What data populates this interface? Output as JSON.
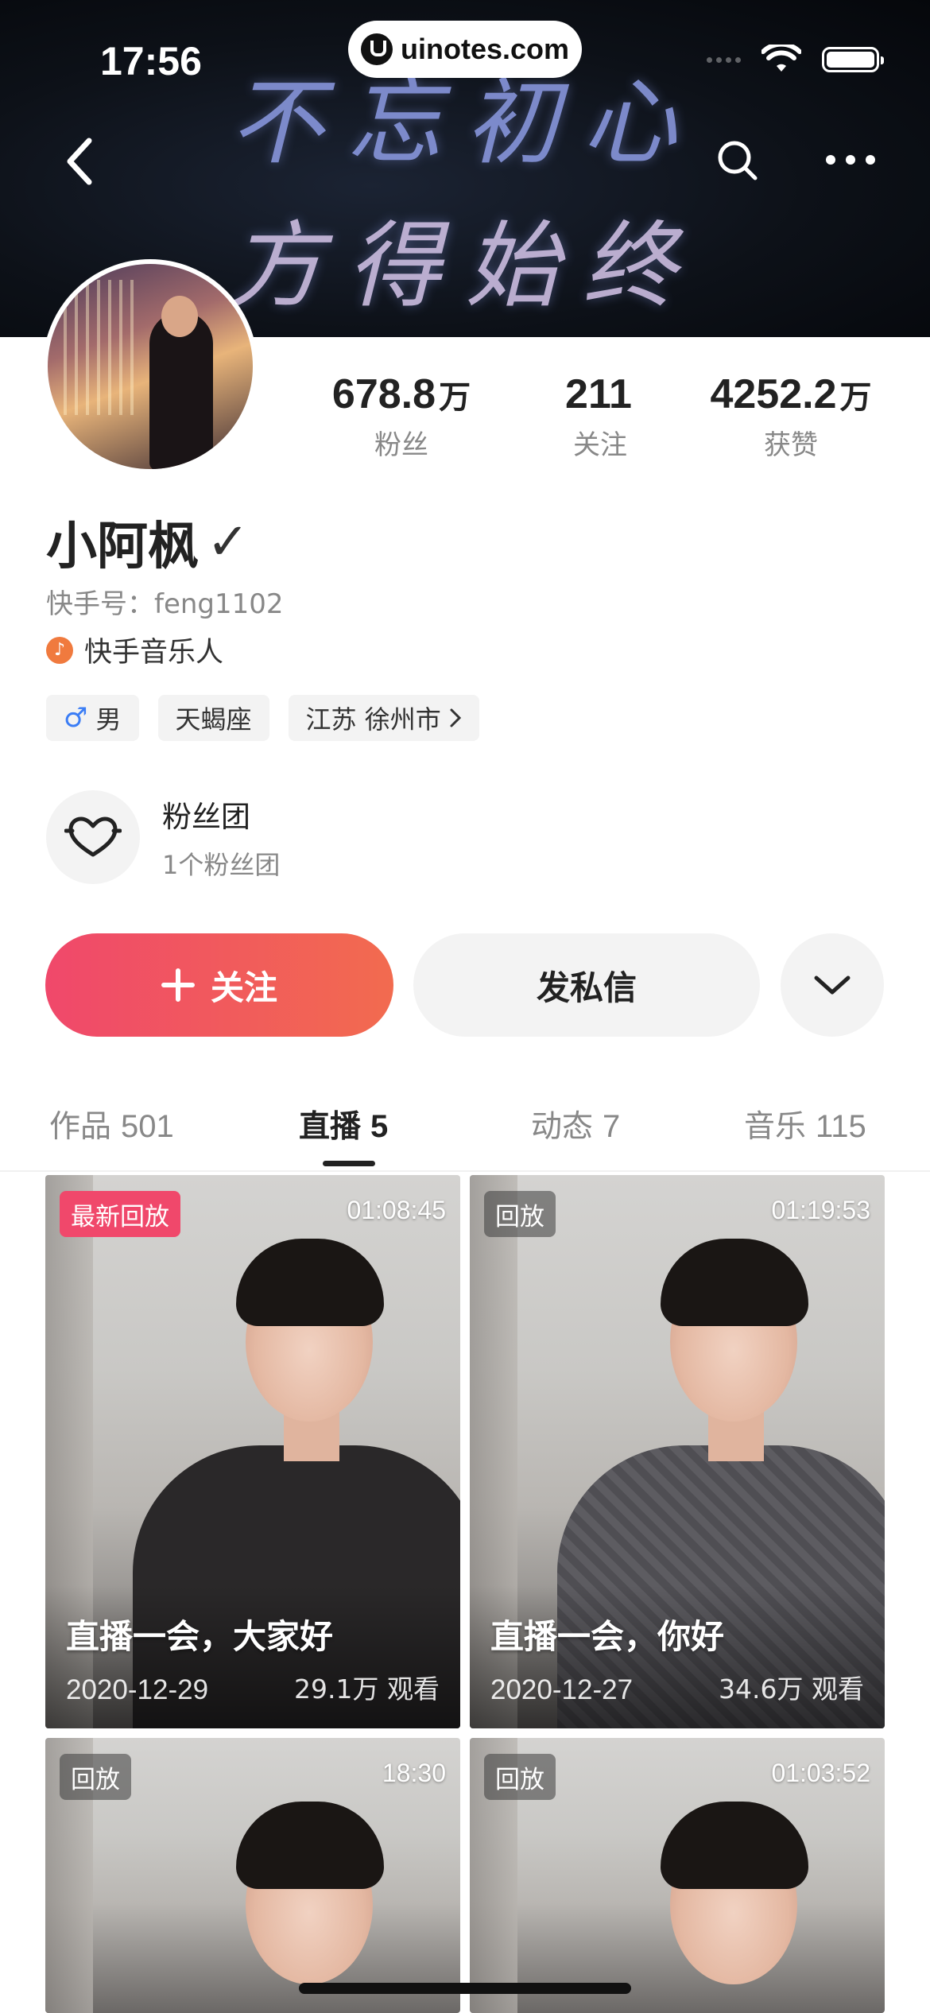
{
  "status_bar": {
    "time": "17:56",
    "url": "uinotes.com"
  },
  "banner": {
    "line1": "不忘初心",
    "line2": "方得始终"
  },
  "nav": {
    "back_icon": "chevron-left-icon",
    "search_icon": "search-icon",
    "more_icon": "more-horizontal-icon"
  },
  "stats": [
    {
      "value": "678.8",
      "unit": "万",
      "label": "粉丝"
    },
    {
      "value": "211",
      "unit": "",
      "label": "关注"
    },
    {
      "value": "4252.2",
      "unit": "万",
      "label": "获赞"
    }
  ],
  "profile": {
    "name": "小阿枫",
    "verified_mark": "✓",
    "kuaishou_id": "快手号：feng1102",
    "music_tag": "快手音乐人",
    "tags": {
      "gender_symbol": "♂",
      "gender": "男",
      "zodiac": "天蝎座",
      "location": "江苏 徐州市"
    }
  },
  "fan_club": {
    "title": "粉丝团",
    "subtitle": "1个粉丝团"
  },
  "actions": {
    "follow": "关注",
    "message": "发私信"
  },
  "tabs": [
    {
      "label": "作品",
      "count": "501"
    },
    {
      "label": "直播",
      "count": "5",
      "active": true
    },
    {
      "label": "动态",
      "count": "7"
    },
    {
      "label": "音乐",
      "count": "115"
    }
  ],
  "videos": [
    {
      "badge": "最新回放",
      "duration": "01:08:45",
      "title": "直播一会，大家好",
      "date": "2020-12-29",
      "views": "29.1万 观看"
    },
    {
      "badge": "回放",
      "duration": "01:19:53",
      "title": "直播一会，你好",
      "date": "2020-12-27",
      "views": "34.6万 观看"
    },
    {
      "badge": "回放",
      "duration": "18:30"
    },
    {
      "badge": "回放",
      "duration": "01:03:52"
    }
  ],
  "colors": {
    "accent_start": "#f0486b",
    "accent_end": "#f26b4f",
    "male": "#3b7df5",
    "music": "#f07a3e"
  }
}
